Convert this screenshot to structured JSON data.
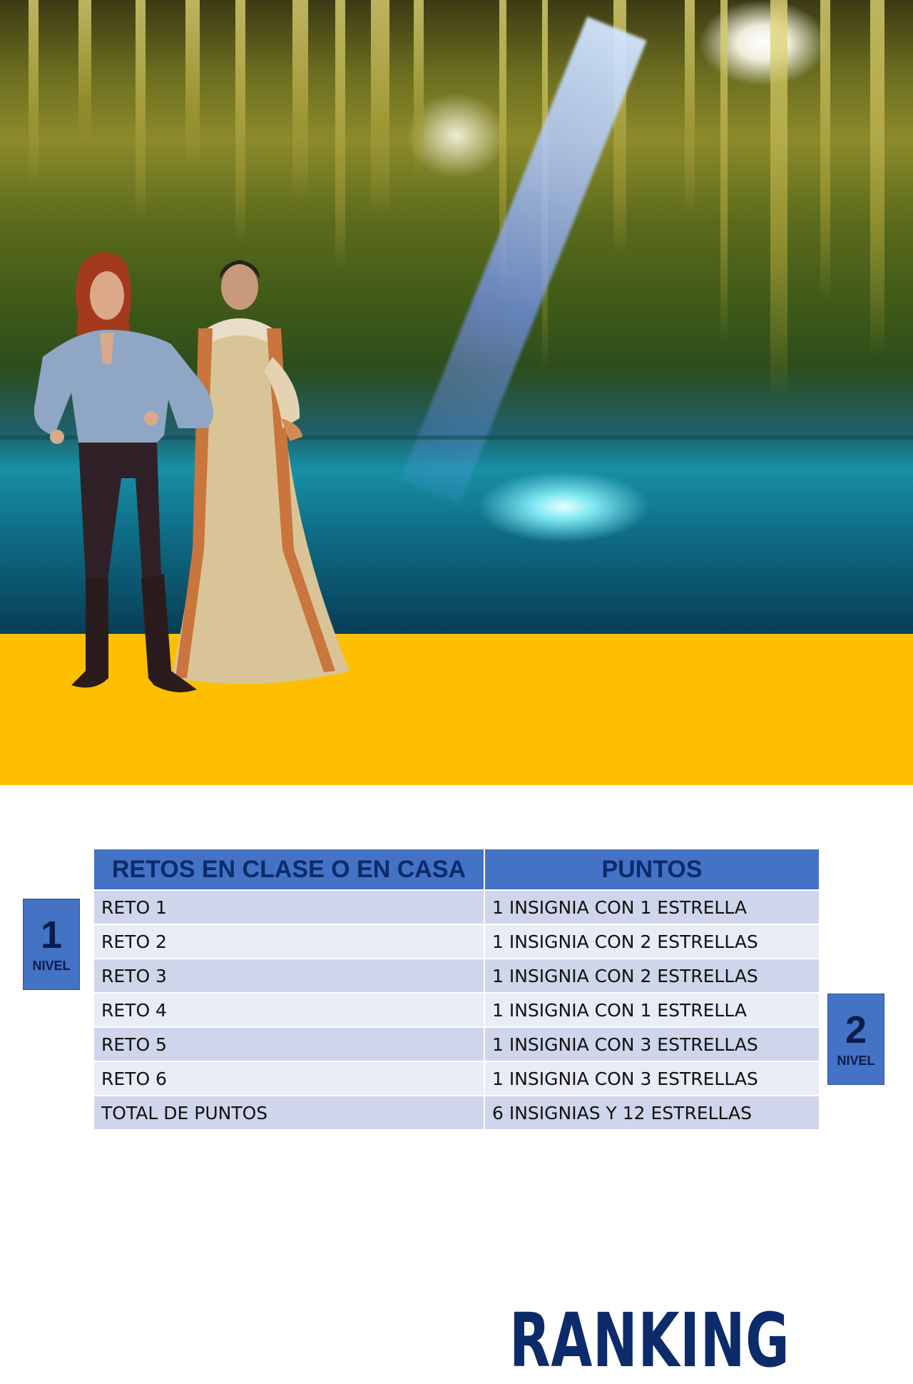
{
  "header": {
    "title": "RANKING"
  },
  "table": {
    "columns": [
      "RETOS EN CLASE O EN CASA",
      "PUNTOS"
    ],
    "rows": [
      {
        "reto": "RETO 1",
        "puntos": "1 INSIGNIA CON 1 ESTRELLA"
      },
      {
        "reto": "RETO 2",
        "puntos": "1 INSIGNIA CON 2 ESTRELLAS"
      },
      {
        "reto": "RETO 3",
        "puntos": "1 INSIGNIA CON 2 ESTRELLAS"
      },
      {
        "reto": "RETO 4",
        "puntos": "1 INSIGNIA CON 1 ESTRELLA"
      },
      {
        "reto": "RETO 5",
        "puntos": "1 INSIGNIA CON 3 ESTRELLAS"
      },
      {
        "reto": "RETO 6",
        "puntos": "1 INSIGNIA CON 3 ESTRELLAS"
      }
    ],
    "total": {
      "label": "TOTAL DE PUNTOS",
      "value": "6 INSIGNIAS   Y 12 ESTRELLAS"
    }
  },
  "levels": [
    {
      "number": "1",
      "label": "NIVEL"
    },
    {
      "number": "2",
      "label": "NIVEL"
    }
  ],
  "colors": {
    "band": "#ffbf00",
    "title": "#0b2b6b",
    "table_header": "#4472c4",
    "row_dark": "#cfd5ea",
    "row_light": "#e9ebf5"
  }
}
